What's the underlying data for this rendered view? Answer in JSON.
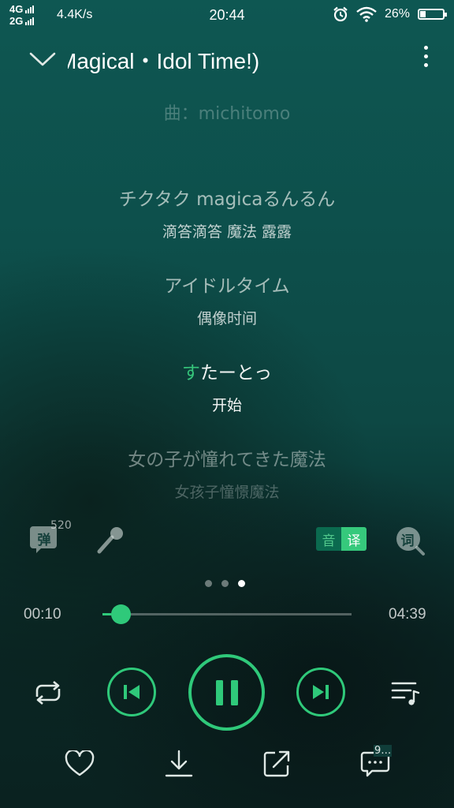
{
  "status_bar": {
    "network_top": "4G",
    "network_bottom": "2G",
    "speed": "4.4K/s",
    "time": "20:44",
    "battery": "26%",
    "battery_level": 0.26
  },
  "header": {
    "title": "Magical・Idol Time!)",
    "composer": "曲：michitomo",
    "icons": {
      "back": "chevron-down-icon",
      "more": "more-vertical-icon"
    }
  },
  "lyrics": [
    {
      "ja": "チクタク magicaるんるん",
      "zh": "滴答滴答 魔法 露露",
      "state": "normal"
    },
    {
      "ja": "アイドルタイム",
      "zh": "偶像时间",
      "state": "normal"
    },
    {
      "ja_highlight": "す",
      "ja_rest": "たーとっ",
      "zh": "开始",
      "state": "active"
    },
    {
      "ja": "女の子が憧れてきた魔法",
      "zh": "女孩子憧憬魔法",
      "state": "dim"
    }
  ],
  "actions": {
    "danmaku_label": "弹",
    "danmaku_count": "520",
    "translate_yin": "音",
    "translate_yi": "译",
    "lyrics_search_label": "词"
  },
  "pager": {
    "count": 3,
    "active": 2
  },
  "progress": {
    "elapsed": "00:10",
    "total": "04:39",
    "fraction": 0.036
  },
  "controls": {
    "repeat": "repeat-icon",
    "previous": "skip-previous-icon",
    "play_pause": "pause-icon",
    "next": "skip-next-icon",
    "playlist": "playlist-icon"
  },
  "bottom": {
    "comments_count": "9…",
    "icons": [
      "heart-icon",
      "download-icon",
      "share-icon",
      "comments-icon"
    ]
  },
  "colors": {
    "accent": "#2fc97a",
    "background_top": "#0e5752",
    "background_bottom": "#0a2220"
  }
}
